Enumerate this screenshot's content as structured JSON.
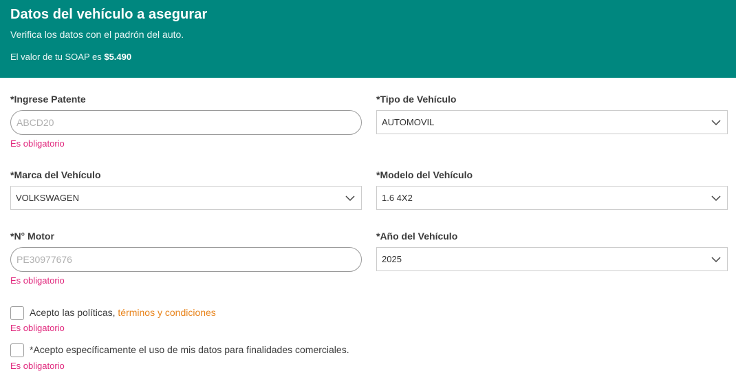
{
  "header": {
    "title": "Datos del vehículo a asegurar",
    "subtitle": "Verifica los datos con el padrón del auto.",
    "soap_prefix": "El valor de tu SOAP es",
    "soap_value": "$5.490",
    "background_color": "#00877f"
  },
  "form": {
    "patente": {
      "label": "*Ingrese Patente",
      "placeholder": "ABCD20",
      "value": "",
      "error": "Es obligatorio"
    },
    "tipo": {
      "label": "*Tipo de Vehículo",
      "selected": "AUTOMOVIL",
      "icon": "chevron-down-icon"
    },
    "marca": {
      "label": "*Marca del Vehículo",
      "selected": "VOLKSWAGEN",
      "icon": "chevron-down-icon"
    },
    "modelo": {
      "label": "*Modelo del Vehículo",
      "selected": "1.6 4X2",
      "icon": "chevron-down-icon"
    },
    "motor": {
      "label": "*N° Motor",
      "placeholder": "PE30977676",
      "value": "",
      "error": "Es obligatorio"
    },
    "anio": {
      "label": "*Año del Vehículo",
      "selected": "2025",
      "icon": "chevron-down-icon"
    }
  },
  "consents": {
    "politicas": {
      "text": "Acepto las políticas,",
      "link": "términos y condiciones",
      "checked": false,
      "error": "Es obligatorio"
    },
    "comerciales": {
      "text": "*Acepto específicamente el uso de mis datos para finalidades comerciales.",
      "checked": false,
      "error": "Es obligatorio"
    }
  },
  "colors": {
    "error": "#e0257b",
    "link": "#e8831a"
  }
}
